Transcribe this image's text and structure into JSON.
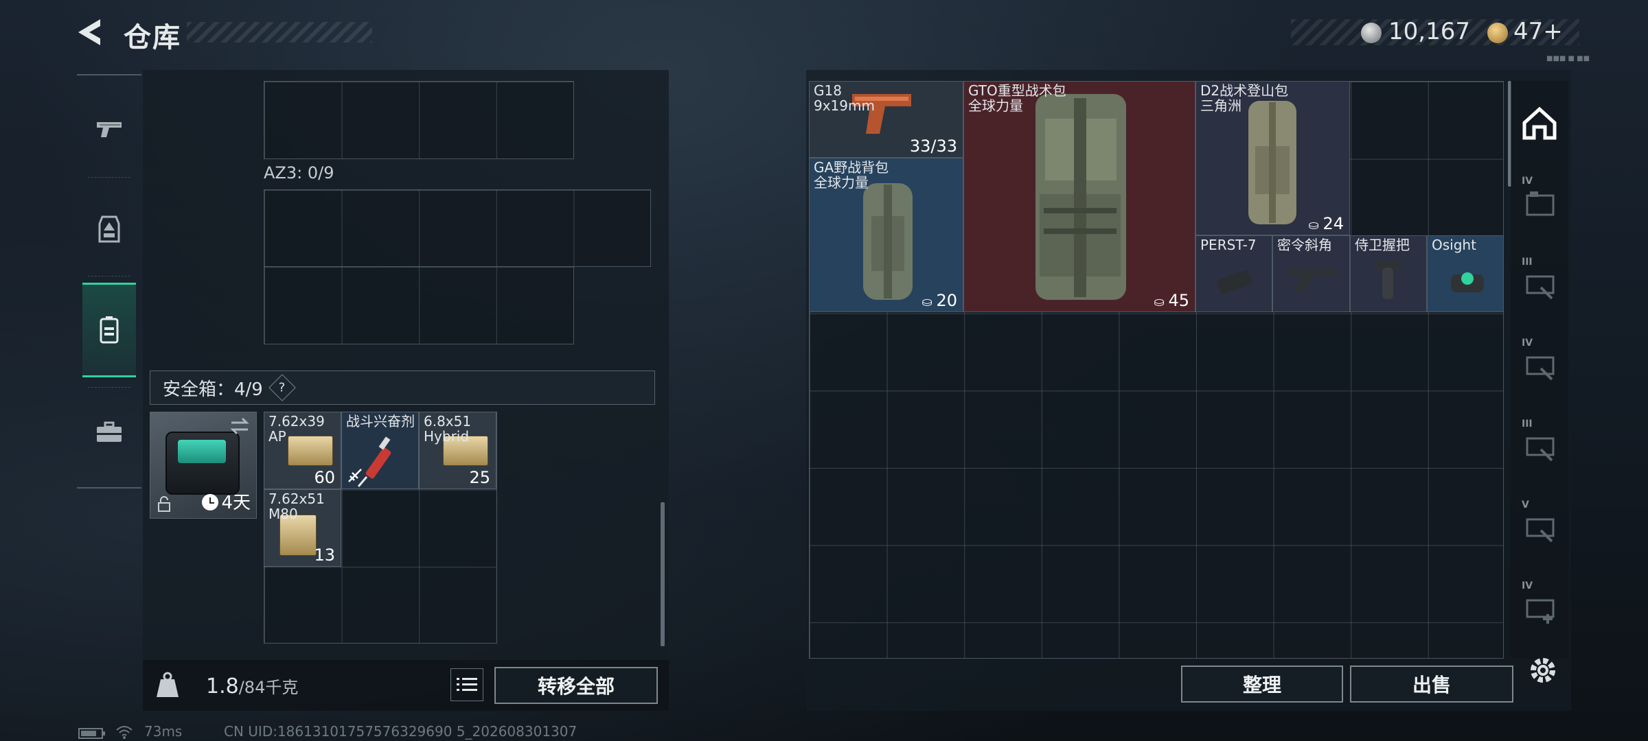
{
  "header": {
    "title": "仓库",
    "currency_silver": "10,167",
    "currency_gold": "47+",
    "tiny_tag": "■■■ ■ ■■"
  },
  "rail": {
    "items": [
      "weapons",
      "armor",
      "backpack",
      "toolbox"
    ],
    "active": "backpack"
  },
  "left": {
    "az3_label": "AZ3: 0/9",
    "safebox_label": "安全箱：4/9",
    "help": "?",
    "safe_case": {
      "days": "4天"
    },
    "safe_items": [
      {
        "name": "7.62x39\nAP",
        "count": "60"
      },
      {
        "name": "战斗兴奋剂",
        "count": ""
      },
      {
        "name": "6.8x51\nHybrid",
        "count": "25"
      },
      {
        "name": "7.62x51\nM80",
        "count": "13"
      }
    ],
    "weight_value": "1.8",
    "weight_max": "/84千克",
    "transfer_all": "转移全部"
  },
  "stash": {
    "items": [
      {
        "name": "G18\n9x19mm",
        "count": "33/33"
      },
      {
        "name": "GTO重型战术包\n全球力量",
        "count": "45"
      },
      {
        "name": "D2战术登山包\n三角洲",
        "count": "24"
      },
      {
        "name": "GA野战背包\n全球力量",
        "count": "20"
      },
      {
        "name": "PERST-7",
        "count": ""
      },
      {
        "name": "密令斜角",
        "count": ""
      },
      {
        "name": "侍卫握把",
        "count": ""
      },
      {
        "name": "Osight",
        "count": ""
      }
    ],
    "sort_label": "整理",
    "sell_label": "出售"
  },
  "side_tabs": [
    {
      "tier": "",
      "icon": "house-icon"
    },
    {
      "tier": "IV",
      "icon": "case-icon"
    },
    {
      "tier": "III",
      "icon": "grip-icon"
    },
    {
      "tier": "IV",
      "icon": "grip-icon"
    },
    {
      "tier": "III",
      "icon": "grip-icon"
    },
    {
      "tier": "V",
      "icon": "grip-icon"
    },
    {
      "tier": "IV",
      "icon": "medkit-icon"
    }
  ],
  "status": {
    "ping": "73ms",
    "uid": "CN UID:18613101757576329690 5_202608301307"
  },
  "colors": {
    "accent": "#2fd39d",
    "backpack_blue": "#27425c",
    "gto_red": "#4a2329",
    "panel": "#141c24"
  }
}
